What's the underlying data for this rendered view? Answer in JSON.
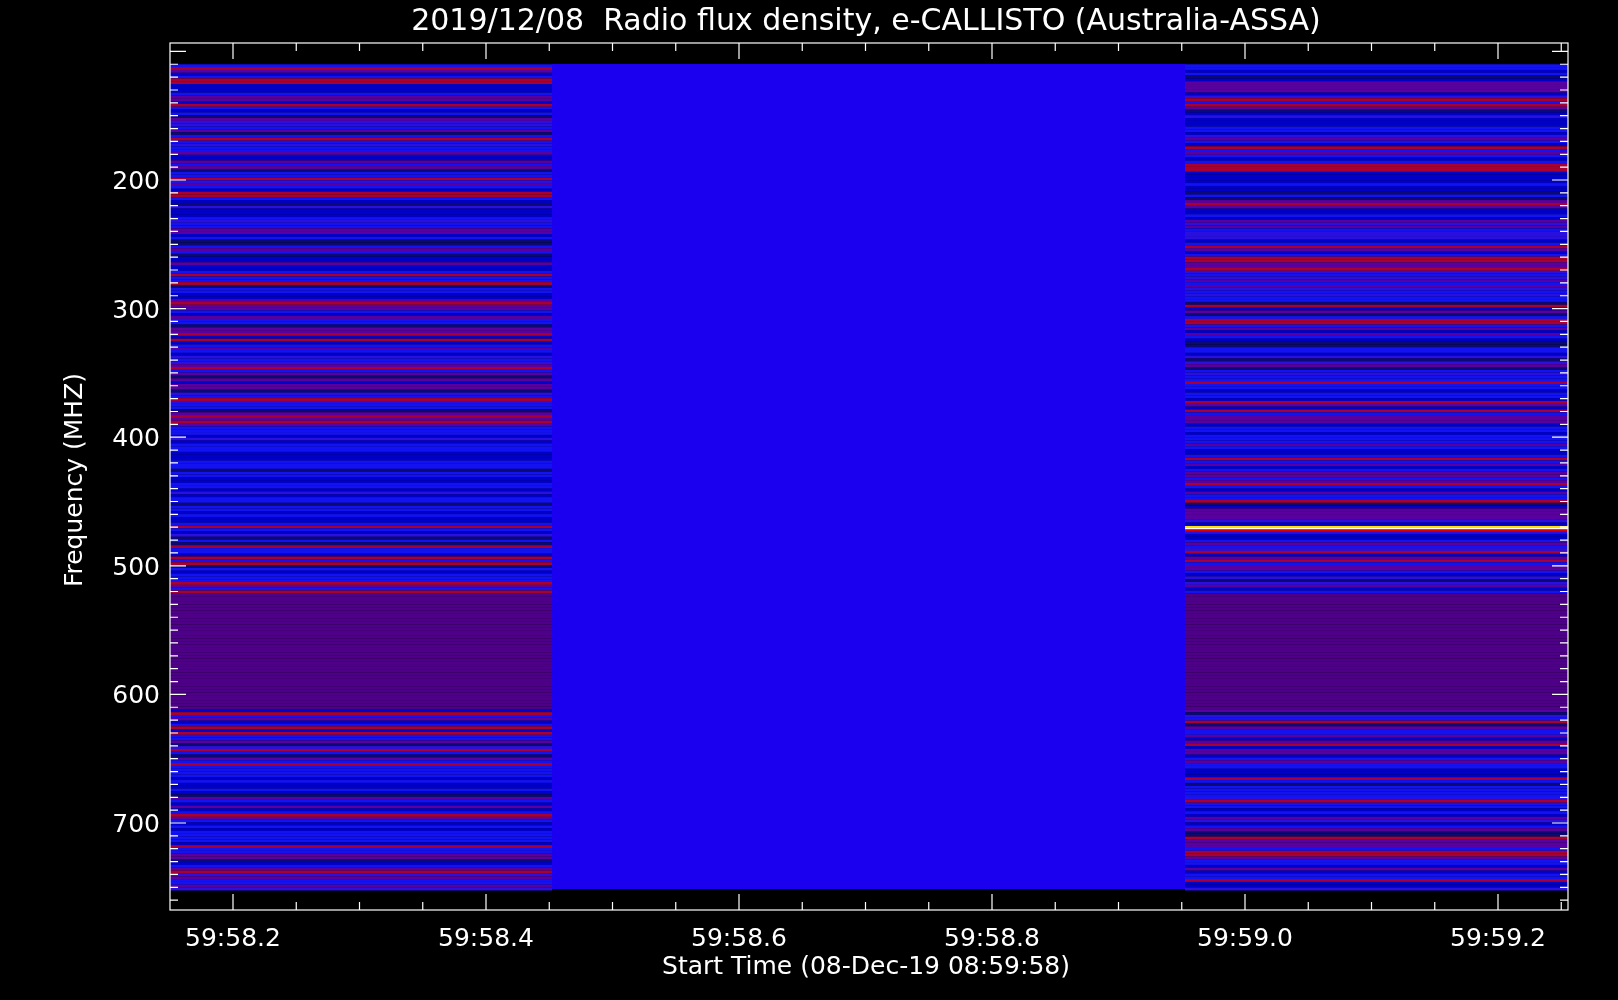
{
  "title": "2019/12/08  Radio flux density, e-CALLISTO (Australia-ASSA)",
  "y_axis": {
    "label": "Frequency (MHZ)",
    "tick_labels": [
      "200",
      "300",
      "400",
      "500",
      "600",
      "700"
    ]
  },
  "x_axis": {
    "label": "Start Time (08-Dec-19 08:59:58)",
    "tick_labels": [
      "59:58.2",
      "59:58.4",
      "59:58.6",
      "59:58.8",
      "59:59.0",
      "59:59.2"
    ]
  }
}
